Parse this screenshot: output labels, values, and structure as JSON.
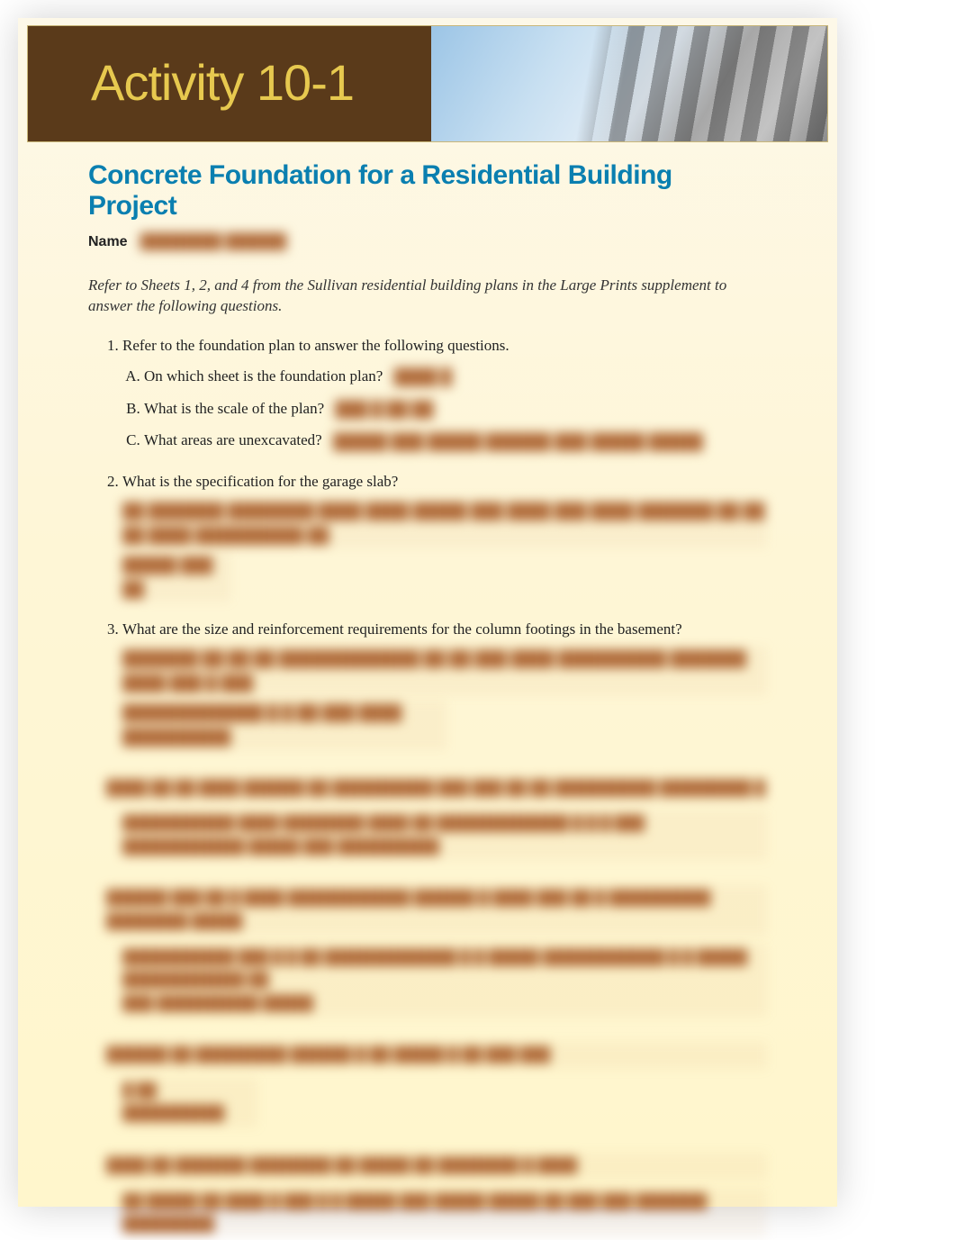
{
  "banner": {
    "title": "Activity 10-1"
  },
  "header": {
    "subtitle": "Concrete Foundation for a Residential Building Project",
    "name_label": "Name",
    "name_value": "████████ ██████"
  },
  "instructions": "Refer to Sheets 1, 2, and 4 from the Sullivan residential building plans in the Large Prints supplement to answer the following questions.",
  "questions": [
    {
      "number": 1,
      "text": "Refer to the foundation plan to answer the following questions.",
      "sub": [
        {
          "letter": "A",
          "text": "On which sheet is the foundation plan?",
          "answer": "████ █"
        },
        {
          "letter": "B",
          "text": "What is the scale of the plan?",
          "answer": "███ █ ██ ██"
        },
        {
          "letter": "C",
          "text": "What areas are unexcavated?",
          "answer": "█████ ███ █████   ██████ ███ █████ █████"
        }
      ]
    },
    {
      "number": 2,
      "text": "What is the specification for the garage slab?",
      "answer_lines": [
        "██ ███████ ████████ ████ ████ █████ ███  ████ ███  ████ ███████ ██ ██ ██  ████ ██████████ ██",
        "█████ ███ ██"
      ]
    },
    {
      "number": 3,
      "text": "What are the size and reinforcement requirements for the column footings in the basement?",
      "answer_lines": [
        "███████ ██   ██     ██ █████████████   ██ ██ ███ ████ ██████████ ███████ ████  ███ █ ███",
        "█████████████   █ █ ██ ███ ████ ██████████"
      ]
    }
  ],
  "obscured_items": [
    {
      "q": "████  ██  ██  ████ ██████  ██  ██████████  ███ ███  ██ ██  ██████████  █████████ █",
      "a": "███████████ ████ ████████  ████ ██  █████████████  █ █ █ ███ ████████████ █████  ███ ██████████"
    },
    {
      "q": "██████ ███  ██ █ ████ ████████████ ██████ █ ████ ███ ██ █ ██████████ ████████ █████",
      "a": "███████████ ███  █    █  ██  █████████████ █ █ █████ ████████████ █ █ █████ ████████████  ██\n███ ██████████ █████"
    },
    {
      "q": "██████ ██ █████████ ██████ █ ██ █████ █ ██ ███ ███",
      "a": "█  ██ ██████████"
    },
    {
      "q": "████  ██ ███████ ████████ ██ █████  ██  ████████ █  ████",
      "a": "██ █████ ██ ████ █ ███ █ █ █████ ███ █████ █████ ██ ███ ███ ███████ █████████"
    }
  ]
}
